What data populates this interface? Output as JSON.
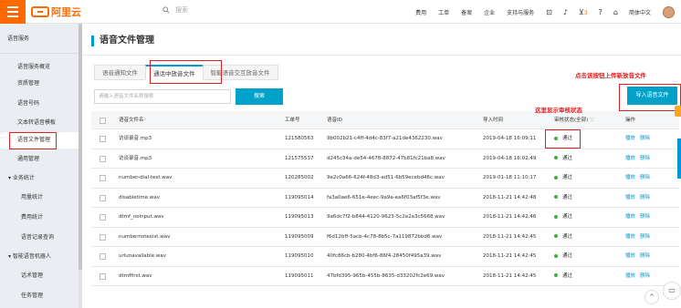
{
  "header": {
    "logo_text": "阿里云",
    "search_placeholder": "搜索",
    "nav": [
      "费用",
      "工单",
      "备案",
      "企业",
      "支持与服务"
    ],
    "cart_count": "3",
    "language": "简体中文"
  },
  "sidebar": {
    "title": "语音服务",
    "items": [
      {
        "label": "语音服务概览",
        "active": false
      },
      {
        "label": "资质管理",
        "active": false
      },
      {
        "label": "语音号码",
        "active": false
      },
      {
        "label": "文本转语音模板",
        "active": false
      },
      {
        "label": "语音文件管理",
        "active": true
      },
      {
        "label": "通用管理",
        "active": false
      }
    ],
    "group_business": "业务统计",
    "business_items": [
      "用量统计",
      "费用统计",
      "语音记录查询"
    ],
    "group_robot": "智能语音机器人",
    "robot_items": [
      "话术管理",
      "任务管理"
    ]
  },
  "main": {
    "title": "语音文件管理",
    "tabs": [
      {
        "label": "语音通知文件",
        "active": false
      },
      {
        "label": "通话中放音文件",
        "active": true
      },
      {
        "label": "智能语音交互放音文件",
        "active": false
      }
    ],
    "search_placeholder": "请输入语音文件名称搜索",
    "search_button": "搜索",
    "upload_button": "导入语音文件",
    "annotation_upload": "点击该按钮上传新放音文件",
    "annotation_status": "这里显示审核状态"
  },
  "table": {
    "headers": {
      "name": "语音文件名",
      "id": "工单号",
      "fid": "语音ID",
      "time": "导入时间",
      "status": "审核状态(全部)",
      "ops": "操作"
    },
    "op_play": "播放",
    "op_delete": "删除",
    "rows": [
      {
        "name": "访谈录音.mp3",
        "id": "121580563",
        "fid": "9b002b21-c4ff-4d4c-83f7-a21de4362230.wav",
        "time": "2019-04-18 16:09:11",
        "status": "通过"
      },
      {
        "name": "访谈录音.mp3",
        "id": "121575537",
        "fid": "d245c34a-de54-4678-8872-47b81fc21ba8.wav",
        "time": "2019-04-18 16:02:49",
        "status": "通过"
      },
      {
        "name": "number-dial-test.wav",
        "id": "120285002",
        "fid": "9e2c0a66-624f-48d3-ad51-6b59ecebd46c.wav",
        "time": "2019-01-18 11:10:17",
        "status": "通过"
      },
      {
        "name": "disabletime.wav",
        "id": "119095014",
        "fid": "fa3a0ae6-651e-4eec-9a9a-ea6f03af5f3e.wav",
        "time": "2018-11-21 14:42:48",
        "status": "通过"
      },
      {
        "name": "dtmf_noinput.wav",
        "id": "119095013",
        "fid": "9a6dc7f2-b844-4120-9623-5c2e2a3c5668.wav",
        "time": "2018-11-21 14:42:46",
        "status": "通过"
      },
      {
        "name": "numbernotexist.wav",
        "id": "119095009",
        "fid": "f6d12bff-5acb-4c78-8b5c-7a119872bbd6.wav",
        "time": "2018-11-21 14:42:45",
        "status": "通过"
      },
      {
        "name": "urlunavailable.wav",
        "id": "119095010",
        "fid": "40fc86cb-b280-4bf6-86f4-28450f495a39.wav",
        "time": "2018-11-21 14:42:45",
        "status": "通过"
      },
      {
        "name": "dtmffirst.wav",
        "id": "119095011",
        "fid": "47bfd395-965b-455b-8635-d33202fc2e69.wav",
        "time": "2018-11-21 14:42:45",
        "status": "通过"
      }
    ]
  },
  "colors": {
    "brand": "#ff6a00",
    "accent": "#00a2ca",
    "annotation": "#e02020",
    "status_ok": "#3cb034"
  }
}
